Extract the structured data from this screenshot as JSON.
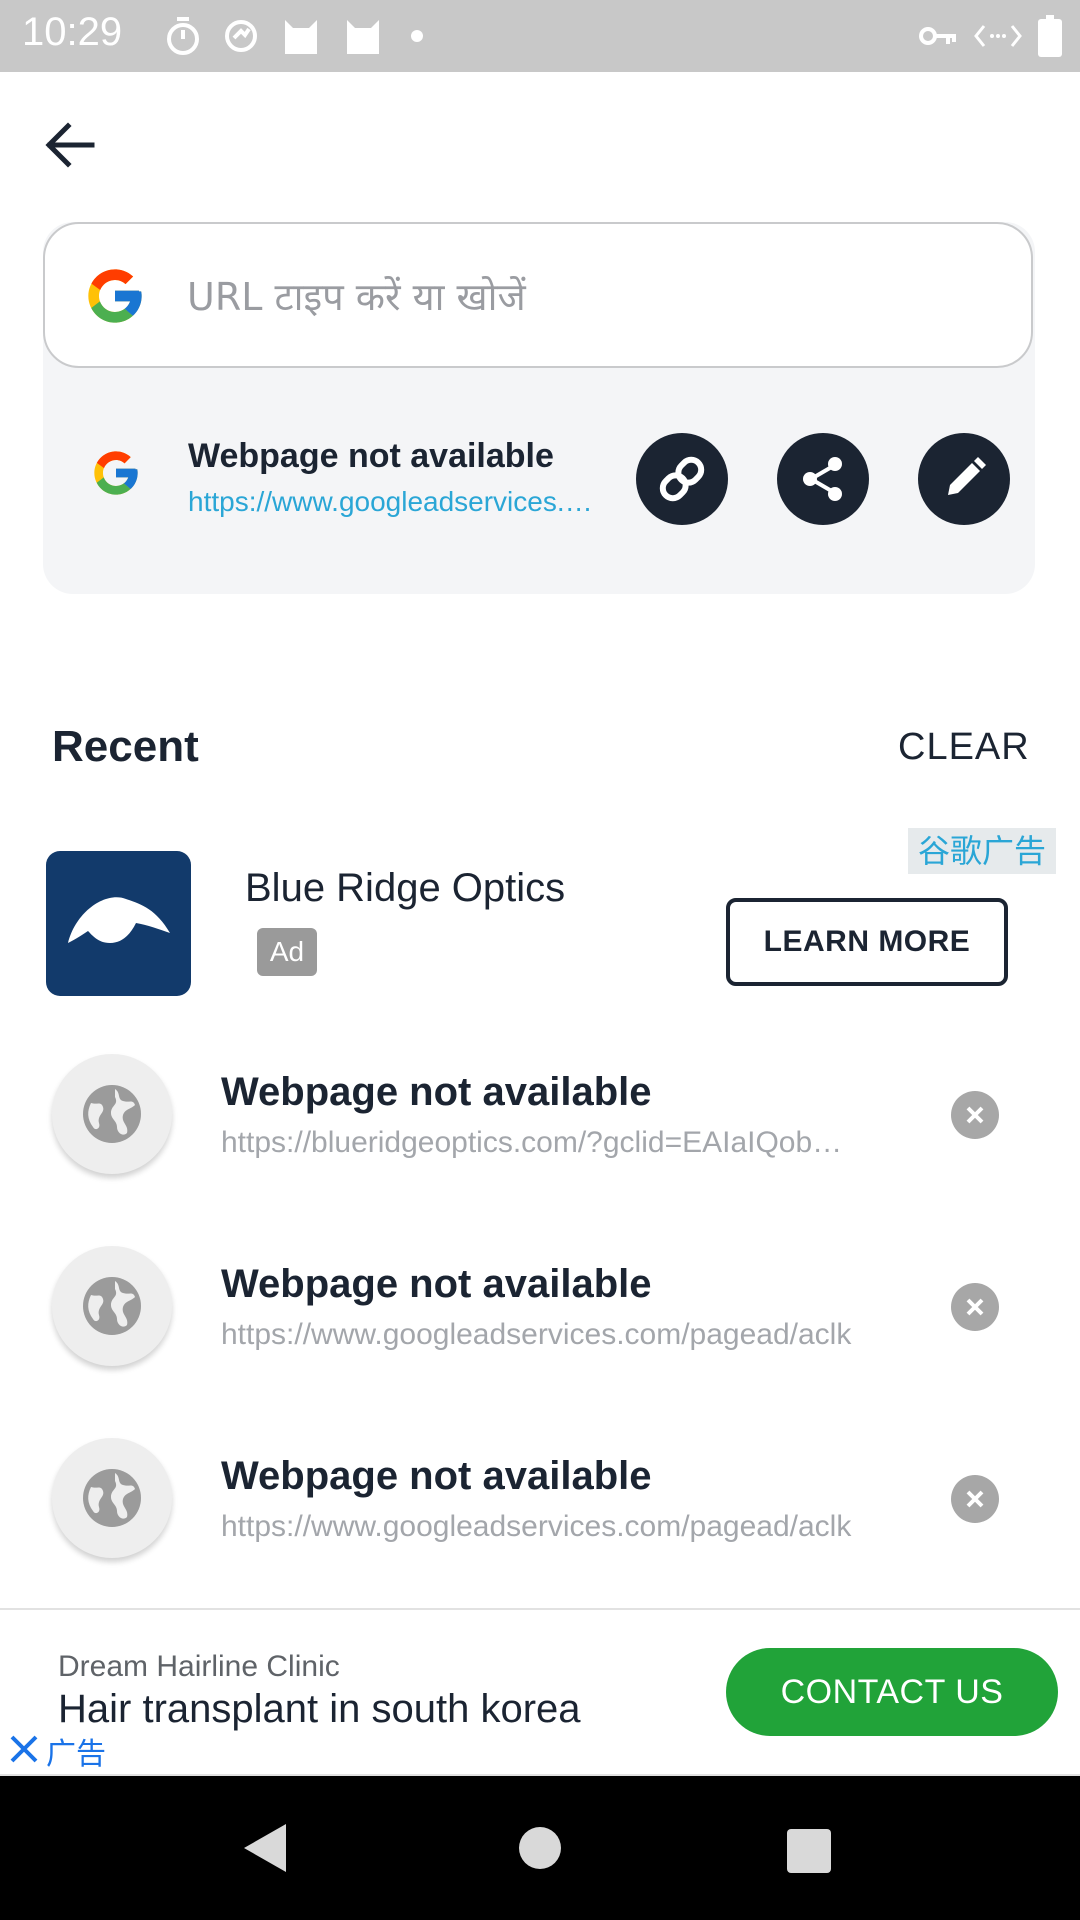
{
  "status_bar": {
    "time": "10:29",
    "left_icons": [
      "timer-icon",
      "sync-icon",
      "cat-icon",
      "cat-icon",
      "dot-icon"
    ],
    "right_icons": [
      "vpn-key-icon",
      "data-icon",
      "battery-icon"
    ]
  },
  "search": {
    "placeholder": "URL टाइप करें या खोजें"
  },
  "current_page": {
    "title": "Webpage not available",
    "url": "https://www.googleadservices.com/pagead/aclk"
  },
  "recent": {
    "heading": "Recent",
    "clear_label": "CLEAR",
    "ad": {
      "label_cn": "谷歌广告",
      "name": "Blue Ridge Optics",
      "badge": "Ad",
      "cta": "LEARN MORE",
      "brand_color": "#123a6b"
    },
    "items": [
      {
        "title": "Webpage not available",
        "url": "https://blueridgeoptics.com/?gclid=EAIaIQobChMI"
      },
      {
        "title": "Webpage not available",
        "url": "https://www.googleadservices.com/pagead/aclk"
      },
      {
        "title": "Webpage not available",
        "url": "https://www.googleadservices.com/pagead/aclk"
      }
    ]
  },
  "bottom_ad": {
    "advertiser": "Dream Hairline Clinic",
    "headline": "Hair transplant in south korea",
    "cta": "CONTACT US",
    "ad_label": "广告",
    "cta_color": "#21a339"
  },
  "colors": {
    "dark": "#1b2432",
    "link": "#2aa6d6",
    "muted": "#a3a6ab"
  }
}
